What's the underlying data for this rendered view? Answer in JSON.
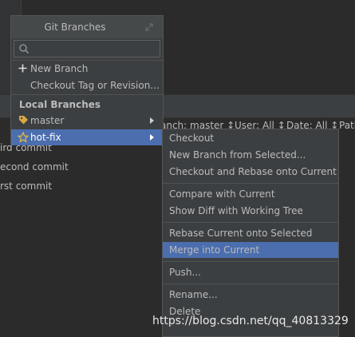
{
  "popup": {
    "title": "Git Branches",
    "search_placeholder": "",
    "actions": [
      {
        "label": "New Branch",
        "icon": "plus-icon"
      },
      {
        "label": "Checkout Tag or Revision..."
      }
    ],
    "section_local": "Local Branches",
    "branches": [
      {
        "label": "master",
        "icon": "tag-icon"
      },
      {
        "label": "hot-fix",
        "icon": "star-icon",
        "selected": true
      }
    ]
  },
  "submenu": {
    "items": [
      "Checkout",
      "New Branch from Selected...",
      "Checkout and Rebase onto Current",
      "Compare with Current",
      "Show Diff with Working Tree",
      "Rebase Current onto Selected",
      "Merge into Current",
      "Push...",
      "Rename...",
      "Delete"
    ],
    "selected_index": 6
  },
  "log_filters": [
    "anch: master ↕",
    "User: All ↕",
    "Date: All ↕",
    "Path"
  ],
  "commits": [
    "ird commit",
    "econd commit",
    "rst commit"
  ],
  "watermark": "https://blog.csdn.net/qq_40813329",
  "colors": {
    "selection": "#4b6eaf",
    "panel": "#3c3f41",
    "background": "#2b2b2b"
  }
}
